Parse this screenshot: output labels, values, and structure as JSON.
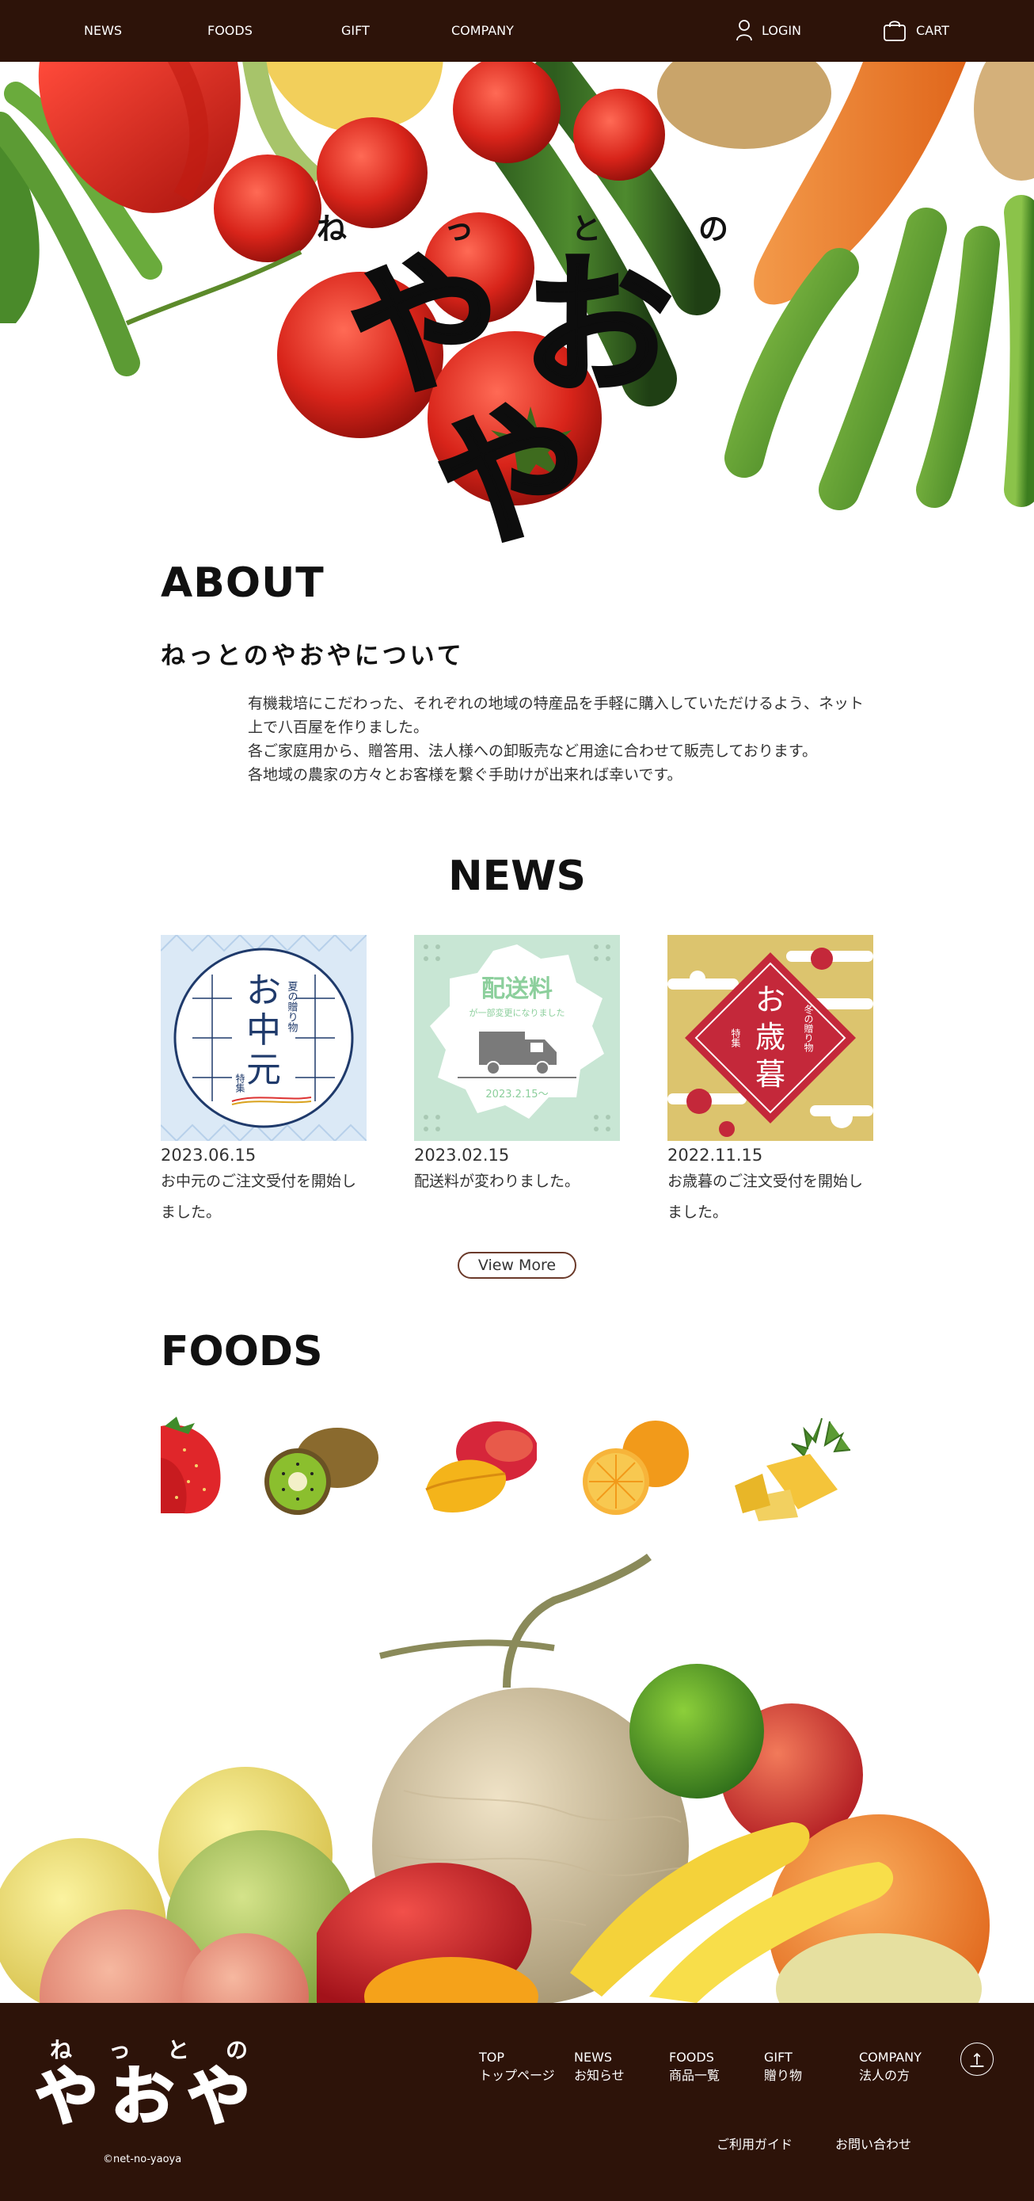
{
  "header": {
    "nav": [
      {
        "label": "NEWS"
      },
      {
        "label": "FOODS"
      },
      {
        "label": "GIFT"
      },
      {
        "label": "COMPANY"
      }
    ],
    "login_label": "LOGIN",
    "cart_label": "CART",
    "login_icon": "user-icon",
    "cart_icon": "shopping-bag-icon",
    "bg_color": "#2d1309"
  },
  "hero": {
    "kana": [
      "ね",
      "っ",
      "と",
      "の"
    ],
    "title": "やおや"
  },
  "about": {
    "heading": "ABOUT",
    "subheading": "ねっとのやおやについて",
    "paragraphs": [
      "有機栽培にこだわった、それぞれの地域の特産品を手軽に購入していただけるよう、ネット上で八百屋を作りました。",
      "各ご家庭用から、贈答用、法人様への卸販売など用途に合わせて販売しております。",
      "各地域の農家の方々とお客様を繋ぐ手助けが出来れば幸いです。"
    ]
  },
  "news": {
    "heading": "NEWS",
    "items": [
      {
        "date": "2023.06.15",
        "text": "お中元のご注文受付を開始しました。",
        "thumb": {
          "small": "夏の贈り物",
          "big1": "お",
          "big2": "中",
          "big3": "元",
          "tag": "特集"
        }
      },
      {
        "date": "2023.02.15",
        "text": "配送料が変わりました。",
        "thumb": {
          "title": "配送料",
          "sub": "が一部変更になりました",
          "date": "2023.2.15〜"
        }
      },
      {
        "date": "2022.11.15",
        "text": "お歳暮のご注文受付を開始しました。",
        "thumb": {
          "small": "冬の贈り物",
          "big1": "お",
          "big2": "歳",
          "big3": "暮",
          "tag": "特集"
        }
      }
    ],
    "view_more": "View More"
  },
  "foods": {
    "heading": "FOODS",
    "items": [
      {
        "icon": "strawberry-icon"
      },
      {
        "icon": "kiwi-icon"
      },
      {
        "icon": "mango-icon"
      },
      {
        "icon": "orange-icon"
      },
      {
        "icon": "pineapple-icon"
      }
    ]
  },
  "footer": {
    "logo_kana": [
      "ね",
      "っ",
      "と",
      "の"
    ],
    "logo_title": "やおや",
    "copyright": "©net-no-yaoya",
    "nav": [
      {
        "en": "TOP",
        "ja": "トップページ"
      },
      {
        "en": "NEWS",
        "ja": "お知らせ"
      },
      {
        "en": "FOODS",
        "ja": "商品一覧"
      },
      {
        "en": "GIFT",
        "ja": "贈り物"
      },
      {
        "en": "COMPANY",
        "ja": "法人の方"
      }
    ],
    "links": [
      "ご利用ガイド",
      "お問い合わせ"
    ],
    "to_top_icon": "arrow-up-icon",
    "to_top": "↑"
  }
}
